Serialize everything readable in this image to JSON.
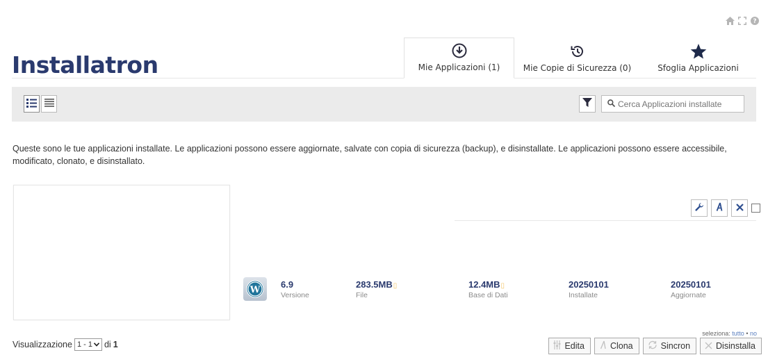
{
  "header": {
    "logo_text": "Installatron",
    "top_icons": [
      "home-icon",
      "fullscreen-icon",
      "help-icon"
    ]
  },
  "tabs": [
    {
      "label": "Mie Applicazioni (1)",
      "icon": "download-circle-icon",
      "active": true
    },
    {
      "label": "Mie Copie di Sicurezza (0)",
      "icon": "history-icon",
      "active": false
    },
    {
      "label": "Sfoglia Applicazioni",
      "icon": "star-icon",
      "active": false
    }
  ],
  "toolbar": {
    "search_placeholder": "Cerca Applicazioni installate"
  },
  "description": "Queste sono le tue applicazioni installate. Le applicazioni possono essere aggiornate, salvate con copia di sicurezza (backup), e disinstallate. Le applicazioni possono essere accessibile, modificato, clonato, e disinstallato.",
  "app": {
    "name_icon": "wordpress-icon",
    "version": "6.9",
    "version_label": "Versione",
    "files": "283.5MB",
    "files_label": "File",
    "db": "12.4MB",
    "db_label": "Base di Dati",
    "installed": "20250101",
    "installed_label": "Installate",
    "updated": "20250101",
    "updated_label": "Aggiornate"
  },
  "selection": {
    "prefix": "seleziona:",
    "all": "tutto",
    "separator": "•",
    "none": "no"
  },
  "pager": {
    "label": "Visualizzazione",
    "range": "1 - 1",
    "of": "di",
    "total": "1"
  },
  "actions": {
    "edit": "Edita",
    "clone": "Clona",
    "sync": "Sincron",
    "uninstall": "Disinstalla"
  },
  "colors": {
    "brand": "#2a3a6e",
    "toolbar_bg": "#ebebeb",
    "link": "#5a7fbf"
  }
}
